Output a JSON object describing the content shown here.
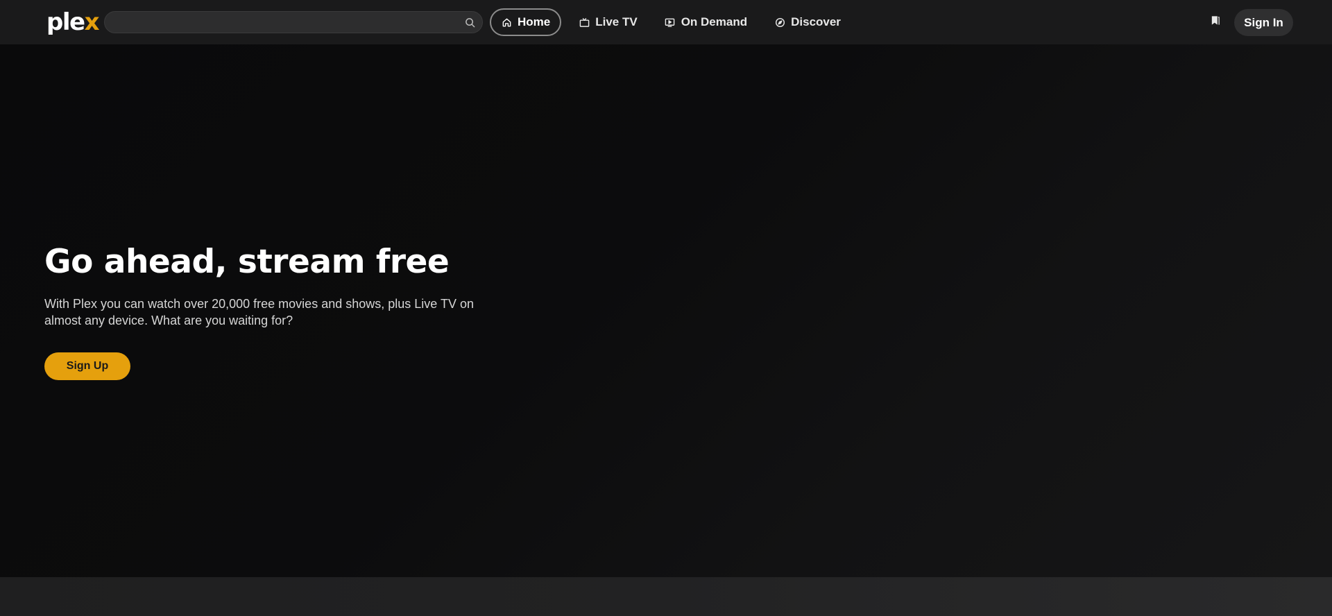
{
  "header": {
    "logo_text_main": "ple",
    "logo_text_accent": "x",
    "search": {
      "placeholder": "",
      "value": ""
    },
    "nav": [
      {
        "label": "Home",
        "icon": "home-icon",
        "active": true
      },
      {
        "label": "Live TV",
        "icon": "tv-icon",
        "active": false
      },
      {
        "label": "On Demand",
        "icon": "play-screen-icon",
        "active": false
      },
      {
        "label": "Discover",
        "icon": "compass-icon",
        "active": false
      }
    ],
    "watchlist_icon": "bookmark-icon",
    "sign_in_label": "Sign In"
  },
  "hero": {
    "title": "Go ahead, stream free",
    "subtitle": "With Plex you can watch over 20,000 free movies and shows, plus Live TV on almost any device. What are you waiting for?",
    "cta_label": "Sign Up"
  },
  "colors": {
    "brand_accent": "#e5a00d",
    "background": "#0c0c0d",
    "header_bg": "#1a1a1b"
  }
}
